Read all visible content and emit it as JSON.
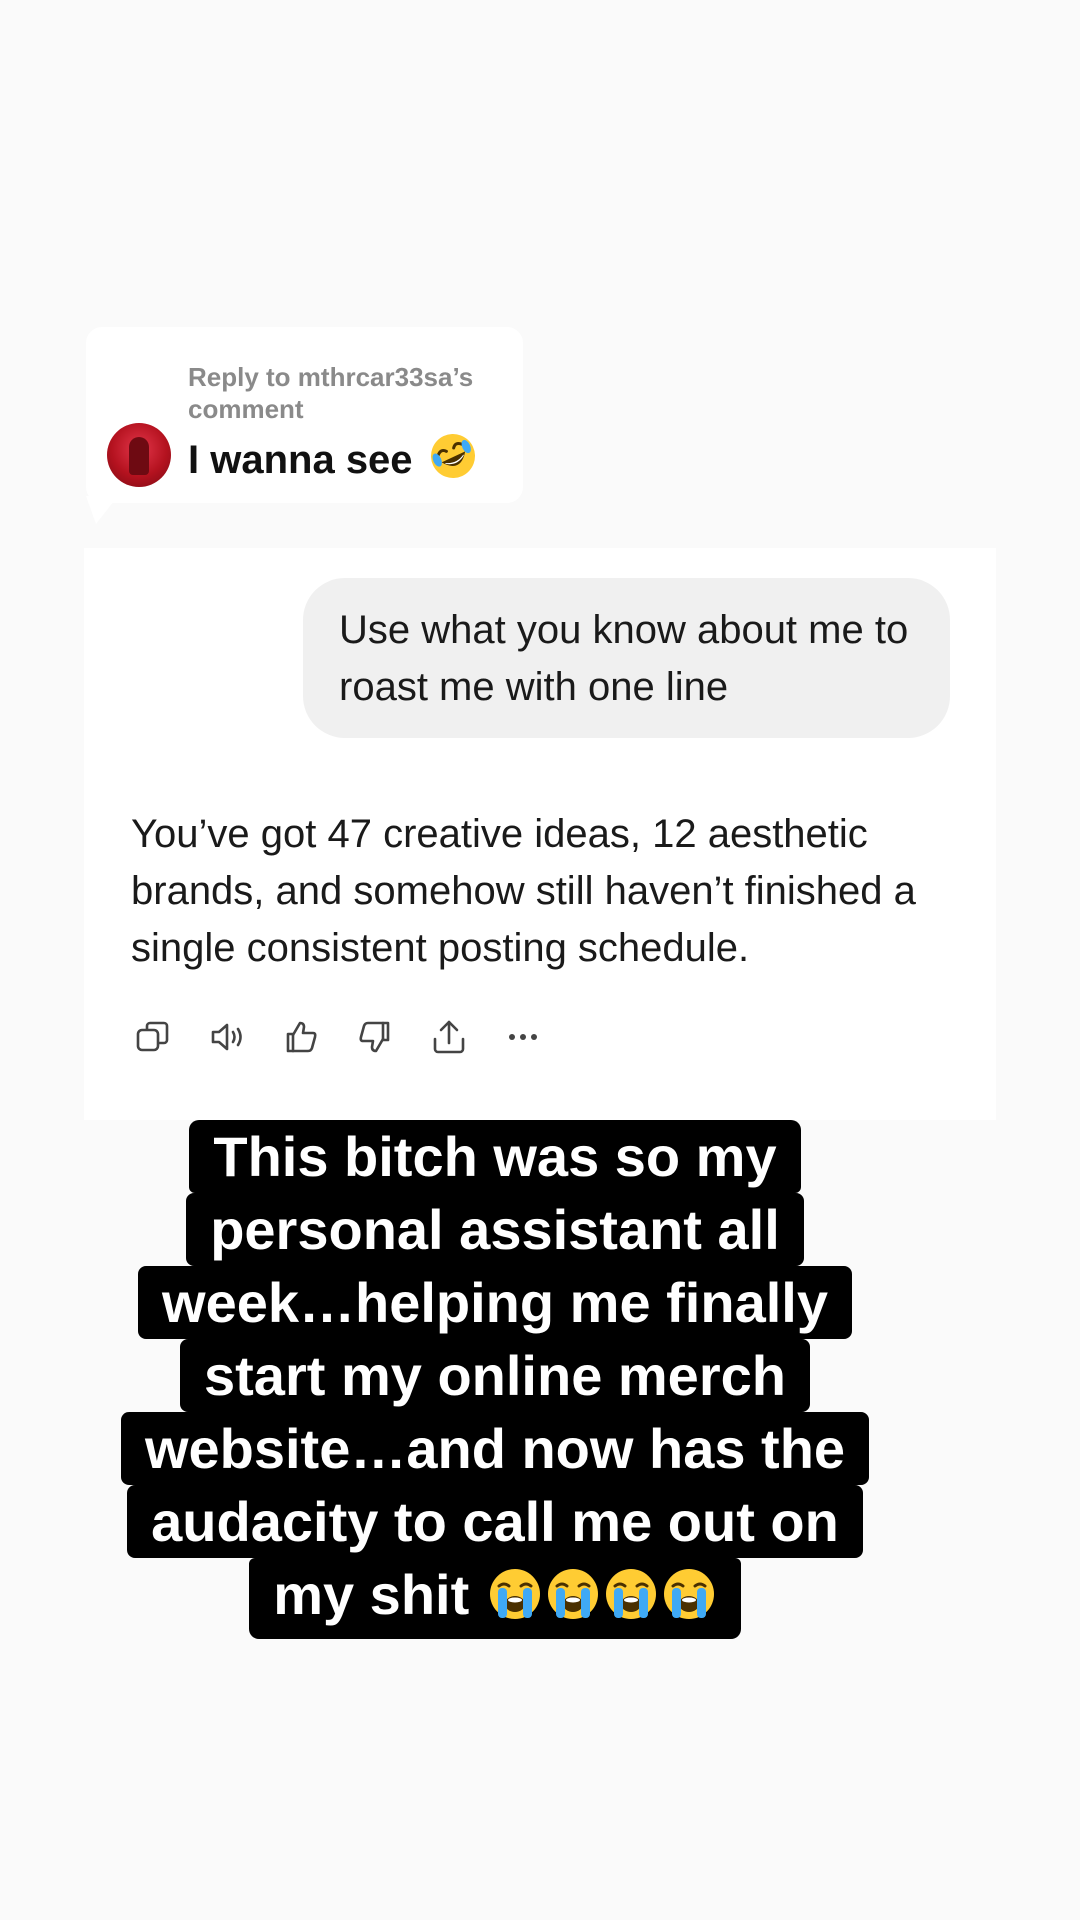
{
  "reply_card": {
    "header": "Reply to mthrcar33sa’s comment",
    "comment_text": "I wanna see",
    "comment_emoji": "rolling-on-floor-laughing-emoji"
  },
  "chat": {
    "user_message": "Use what you know about me to roast me with one line",
    "assistant_message": "You’ve got 47 creative ideas, 12 aesthetic brands, and somehow still haven’t finished a single consistent posting schedule.",
    "actions": [
      {
        "icon": "copy-icon"
      },
      {
        "icon": "speaker-icon"
      },
      {
        "icon": "thumbs-up-icon"
      },
      {
        "icon": "thumbs-down-icon"
      },
      {
        "icon": "share-icon"
      },
      {
        "icon": "more-icon"
      }
    ]
  },
  "caption": {
    "lines": [
      "This bitch was so my",
      "personal assistant all",
      "week…helping me finally",
      "start my online merch",
      "website…and now has the",
      "audacity to call me out on",
      "my shit"
    ],
    "trailing_emoji": "loudly-crying-face-emoji",
    "trailing_emoji_count": 4
  },
  "colors": {
    "background": "#fafafa",
    "user_bubble": "#f0f0f0",
    "caption_bg": "#000000",
    "caption_text": "#ffffff"
  }
}
